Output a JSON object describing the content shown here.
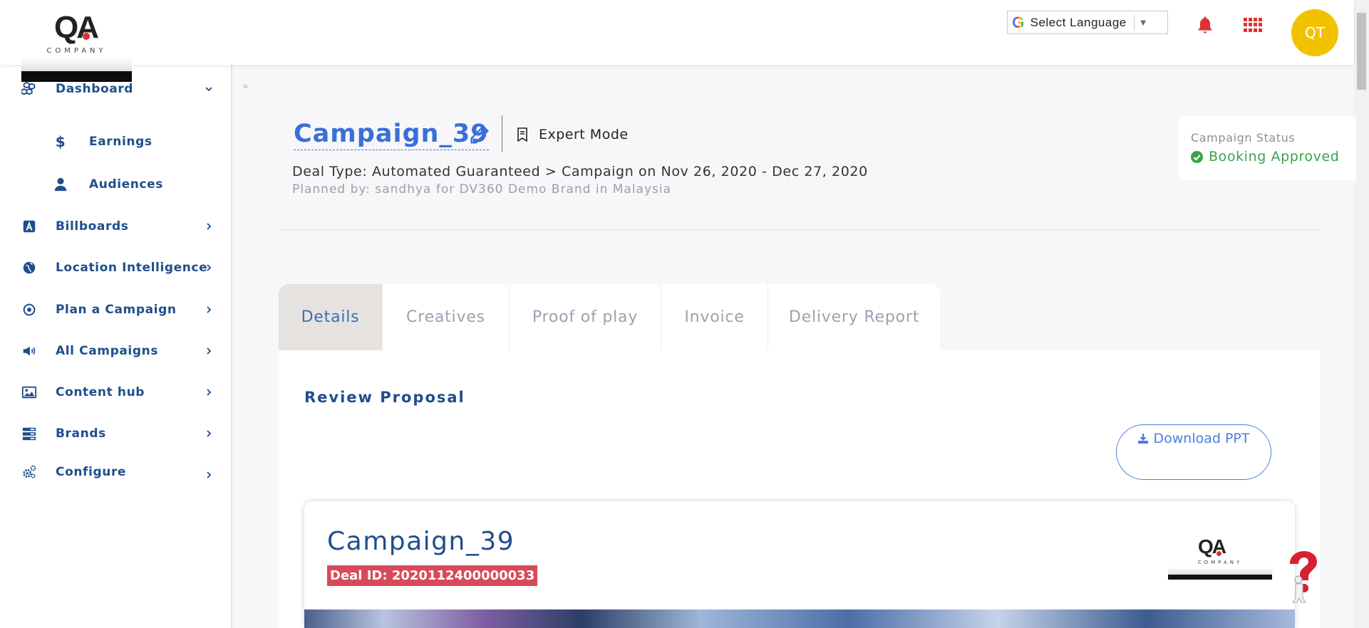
{
  "header": {
    "logo": {
      "wordmark": "QA",
      "subtitle": "COMPANY"
    },
    "language": {
      "label": "Select Language",
      "icon": "google-g-icon"
    },
    "notifications_icon": "bell-icon",
    "apps_icon": "grid-icon",
    "avatar_initials": "QT"
  },
  "sidebar": {
    "items": [
      {
        "label": "Dashboard",
        "icon": "cubes-icon",
        "expanded": true
      },
      {
        "label": "Earnings",
        "icon": "dollar-icon",
        "sub": true
      },
      {
        "label": "Audiences",
        "icon": "user-icon",
        "sub": true
      },
      {
        "label": "Billboards",
        "icon": "billboard-icon"
      },
      {
        "label": "Location Intelligence",
        "icon": "globe-icon"
      },
      {
        "label": "Plan a Campaign",
        "icon": "target-icon"
      },
      {
        "label": "All Campaigns",
        "icon": "megaphone-icon"
      },
      {
        "label": "Content hub",
        "icon": "image-icon"
      },
      {
        "label": "Brands",
        "icon": "brands-icon"
      },
      {
        "label": "Configure",
        "icon": "cogs-icon"
      }
    ]
  },
  "campaign": {
    "title": "Campaign_39",
    "expert_mode": "Expert Mode",
    "deal_line": "Deal Type: Automated Guaranteed > Campaign on Nov 26, 2020 - Dec 27, 2020",
    "planned_by": "Planned by: sandhya for DV360 Demo Brand in Malaysia"
  },
  "status": {
    "label": "Campaign Status",
    "value": "Booking Approved",
    "color": "#3aa24d"
  },
  "tabs": [
    {
      "label": "Details",
      "active": true
    },
    {
      "label": "Creatives"
    },
    {
      "label": "Proof of play"
    },
    {
      "label": "Invoice"
    },
    {
      "label": "Delivery Report"
    }
  ],
  "proposal": {
    "heading": "Review Proposal",
    "download_label": "Download PPT",
    "card_title": "Campaign_39",
    "deal_id": "Deal ID: 2020112400000033"
  },
  "colors": {
    "brand_blue": "#1f4e8c",
    "accent_blue": "#3a6fd8",
    "alert_red": "#e03131",
    "avatar_yellow": "#f2c200"
  }
}
